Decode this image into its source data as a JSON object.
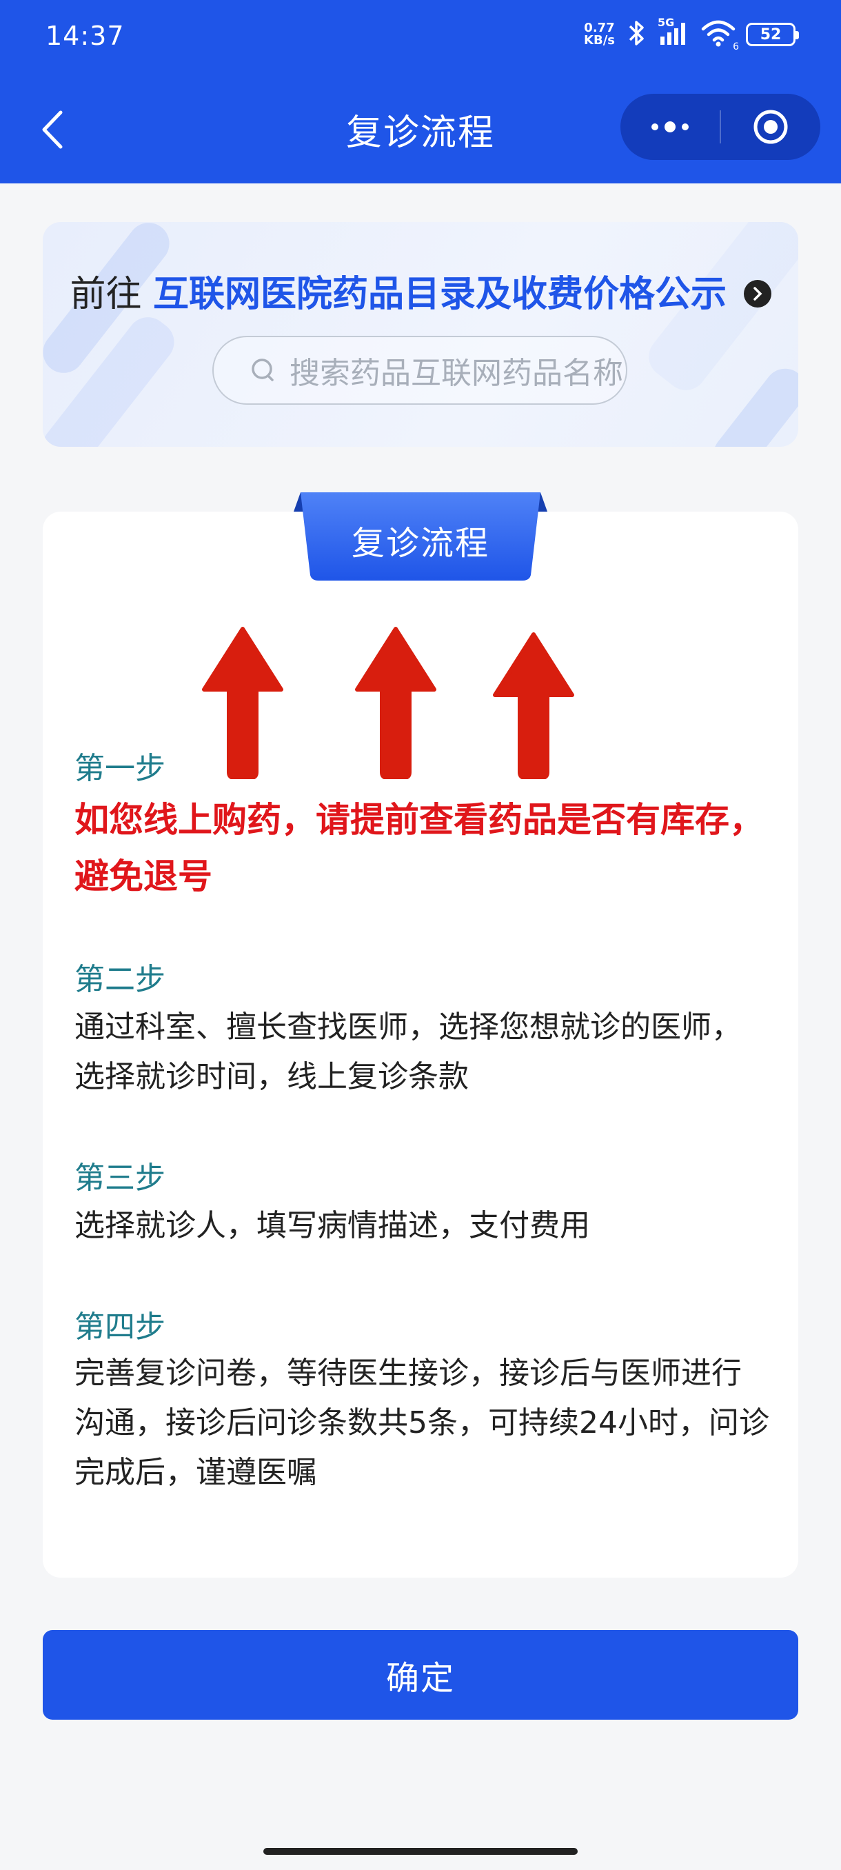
{
  "status_bar": {
    "time": "14:37",
    "net_speed_value": "0.77",
    "net_speed_unit": "KB/s",
    "signal_label": "5G",
    "wifi_label": "6",
    "battery": "52",
    "icons": [
      "bluetooth-icon",
      "signal-icon",
      "wifi-icon",
      "battery-icon"
    ]
  },
  "nav": {
    "title": "复诊流程",
    "icons": [
      "back-icon",
      "more-icon",
      "target-icon"
    ]
  },
  "banner": {
    "prefix": "前往",
    "link_text": "互联网医院药品目录及收费价格公示",
    "search_placeholder": "搜索药品互联网药品名称"
  },
  "card": {
    "ribbon_label": "复诊流程",
    "steps": [
      {
        "title": "第一步",
        "body": "如您线上购药，请提前查看药品是否有库存，避免退号"
      },
      {
        "title": "第二步",
        "body": "通过科室、擅长查找医师，选择您想就诊的医师，选择就诊时间，线上复诊条款"
      },
      {
        "title": "第三步",
        "body": "选择就诊人，填写病情描述，支付费用"
      },
      {
        "title": "第四步",
        "body": "完善复诊问卷，等待医生接诊，接诊后与医师进行沟通，接诊后问诊条数共5条，可持续24小时，问诊完成后，谨遵医嘱"
      }
    ]
  },
  "confirm_label": "确定",
  "colors": {
    "primary": "#1f55e8",
    "highlight_red": "#e0161b",
    "step_title": "#1f7c8c",
    "arrow_red": "#d81e0e"
  }
}
